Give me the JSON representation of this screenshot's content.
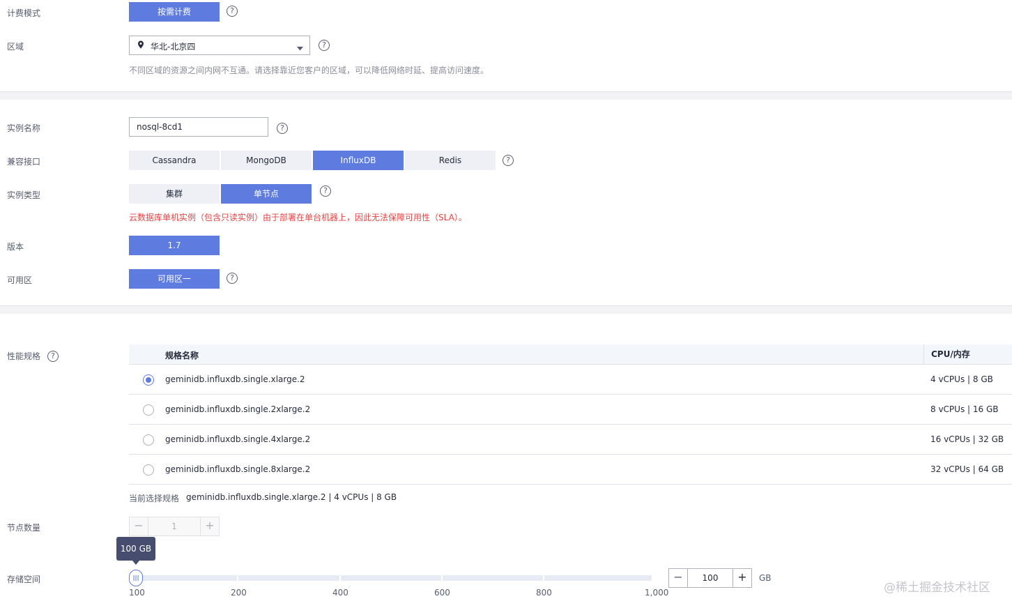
{
  "billing": {
    "label": "计费模式",
    "value": "按需计费"
  },
  "region": {
    "label": "区域",
    "value": "华北-北京四",
    "hint": "不同区域的资源之间内网不互通。请选择靠近您客户的区域，可以降低网络时延、提高访问速度。"
  },
  "instance_name": {
    "label": "实例名称",
    "value": "nosql-8cd1"
  },
  "compat": {
    "label": "兼容接口",
    "options": [
      "Cassandra",
      "MongoDB",
      "InfluxDB",
      "Redis"
    ],
    "selected": "InfluxDB"
  },
  "instance_type": {
    "label": "实例类型",
    "options": [
      "集群",
      "单节点"
    ],
    "selected": "单节点",
    "warning": "云数据库单机实例（包含只读实例）由于部署在单台机器上，因此无法保障可用性（SLA）。"
  },
  "version": {
    "label": "版本",
    "value": "1.7"
  },
  "az": {
    "label": "可用区",
    "value": "可用区一"
  },
  "spec": {
    "label": "性能规格",
    "columns": [
      "规格名称",
      "CPU/内存"
    ],
    "rows": [
      {
        "name": "geminidb.influxdb.single.xlarge.2",
        "cpu": "4 vCPUs | 8 GB",
        "selected": true
      },
      {
        "name": "geminidb.influxdb.single.2xlarge.2",
        "cpu": "8 vCPUs | 16 GB",
        "selected": false
      },
      {
        "name": "geminidb.influxdb.single.4xlarge.2",
        "cpu": "16 vCPUs | 32 GB",
        "selected": false
      },
      {
        "name": "geminidb.influxdb.single.8xlarge.2",
        "cpu": "32 vCPUs | 64 GB",
        "selected": false
      }
    ],
    "current_label": "当前选择规格",
    "current_value": "geminidb.influxdb.single.xlarge.2 | 4 vCPUs | 8 GB"
  },
  "nodes": {
    "label": "节点数量",
    "value": "1",
    "minus": "−",
    "plus": "+"
  },
  "storage": {
    "label": "存储空间",
    "tooltip": "100 GB",
    "value": "100",
    "unit": "GB",
    "ticks": [
      "100",
      "200",
      "400",
      "600",
      "800",
      "1,000"
    ],
    "minus": "−",
    "plus": "+"
  },
  "help_glyph": "?",
  "watermark": "@稀土掘金技术社区",
  "colors": {
    "primary": "#5e7ce0",
    "warning": "#e54545",
    "segment_bg": "#eef0f5"
  }
}
